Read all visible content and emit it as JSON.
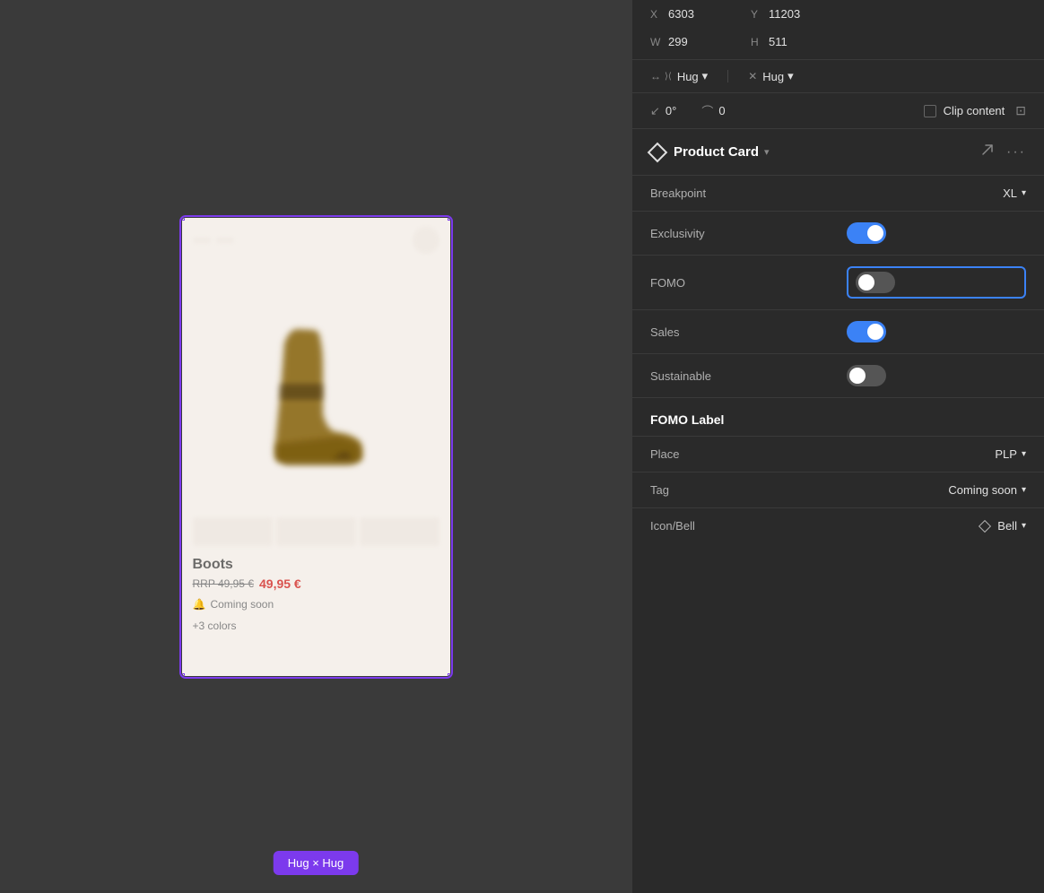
{
  "canvas": {
    "label": "Hug × Hug",
    "card": {
      "title": "Boots",
      "price_original": "RRP 49,95 €",
      "price_current": "49,95 €",
      "coming_soon": "Coming soon",
      "colors": "+3 colors"
    }
  },
  "panel": {
    "dimensions": {
      "x_label": "X",
      "x_value": "6303",
      "y_label": "Y",
      "y_value": "11203",
      "w_label": "W",
      "w_value": "299",
      "h_label": "H",
      "h_value": "511"
    },
    "sizing": {
      "h_icon": "↔",
      "h_label": "Hug",
      "v_icon": "↕",
      "v_label": "Hug"
    },
    "rotation": {
      "icon": "↙",
      "value": "0°",
      "corner_icon": "⌒",
      "corner_value": "0",
      "clip_label": "Clip content"
    },
    "component": {
      "name": "Product Card",
      "chevron": "▾"
    },
    "properties": {
      "breakpoint_label": "Breakpoint",
      "breakpoint_value": "XL",
      "exclusivity_label": "Exclusivity",
      "exclusivity_state": "on",
      "fomo_label": "FOMO",
      "fomo_state": "off",
      "sales_label": "Sales",
      "sales_state": "on",
      "sustainable_label": "Sustainable",
      "sustainable_state": "off"
    },
    "fomo_label_section": {
      "title": "FOMO Label",
      "place_label": "Place",
      "place_value": "PLP",
      "tag_label": "Tag",
      "tag_value": "Coming soon",
      "icon_bell_label": "Icon/Bell",
      "icon_bell_value": "Bell"
    }
  }
}
